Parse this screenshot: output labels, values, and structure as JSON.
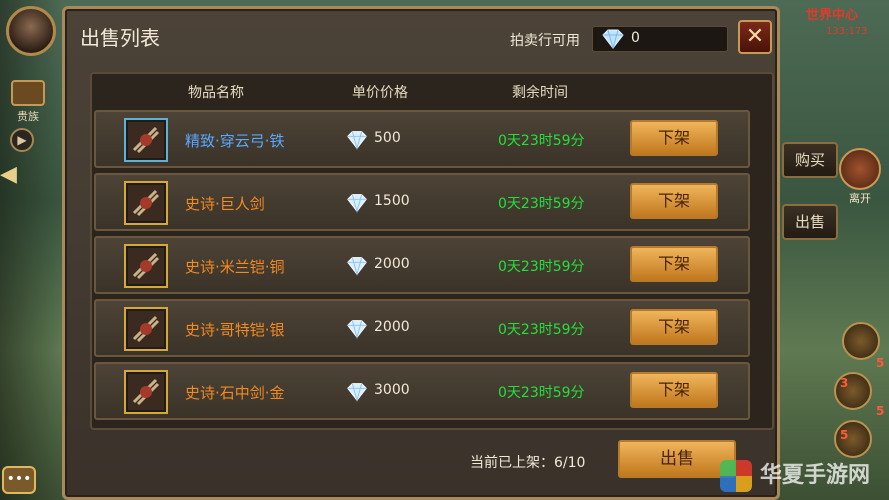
{
  "hud": {
    "guild_label": "贵族",
    "world_title": "世界中心",
    "world_coord": "133:173",
    "side_buy": "购买",
    "side_sell": "出售",
    "side_leave": "离开",
    "badge_one": "5",
    "badge_two": "3",
    "badge_three": "5",
    "badge_four": "5"
  },
  "panel": {
    "title": "出售列表",
    "auction_label": "拍卖行可用",
    "auction_value": "0",
    "close_label": "✕"
  },
  "columns": {
    "name": "物品名称",
    "price": "单价价格",
    "time": "剩余时间"
  },
  "rows": [
    {
      "name": "精致·穿云弓·铁",
      "price": "500",
      "time": "0天23时59分",
      "action": "下架",
      "quality": "blue"
    },
    {
      "name": "史诗·巨人剑",
      "price": "1500",
      "time": "0天23时59分",
      "action": "下架",
      "quality": "orange"
    },
    {
      "name": "史诗·米兰铠·铜",
      "price": "2000",
      "time": "0天23时59分",
      "action": "下架",
      "quality": "orange"
    },
    {
      "name": "史诗·哥特铠·银",
      "price": "2000",
      "time": "0天23时59分",
      "action": "下架",
      "quality": "orange"
    },
    {
      "name": "史诗·石中剑·金",
      "price": "3000",
      "time": "0天23时59分",
      "action": "下架",
      "quality": "orange"
    }
  ],
  "footer": {
    "listed": "当前已上架：6/10",
    "sell_label": "出售"
  },
  "watermark": "华夏手游网"
}
